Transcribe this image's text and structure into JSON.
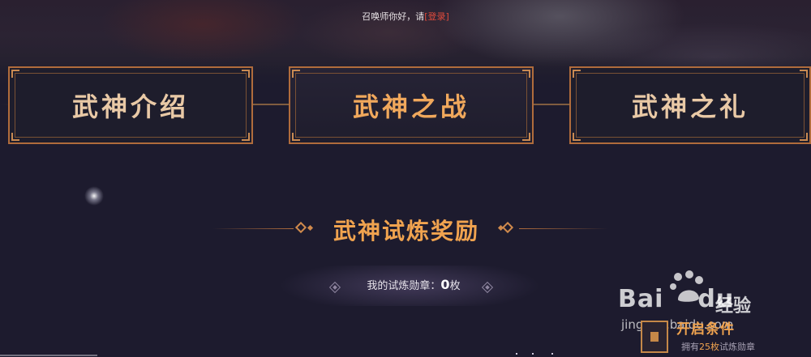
{
  "header": {
    "greeting": "召唤师你好，请",
    "login_label": "[登录]"
  },
  "tabs": [
    {
      "label": "武神介绍",
      "active": false
    },
    {
      "label": "武神之战",
      "active": true
    },
    {
      "label": "武神之礼",
      "active": false
    }
  ],
  "section": {
    "title": "武神试炼奖励"
  },
  "medals": {
    "label": "我的试炼勋章：",
    "count": "0",
    "unit": "枚"
  },
  "watermark": {
    "logo": "Bai",
    "logo_mid": "du",
    "suffix": "经验",
    "url": "jingyan.baidu.com"
  },
  "condition": {
    "title": "开启条件",
    "desc_prefix": "拥有",
    "desc_num": "25枚",
    "desc_suffix": "试炼勋章"
  },
  "colors": {
    "accent": "#f0a34f",
    "frame": "#b06c3c",
    "login_link": "#e14b3c",
    "background": "#1d1b2e"
  }
}
